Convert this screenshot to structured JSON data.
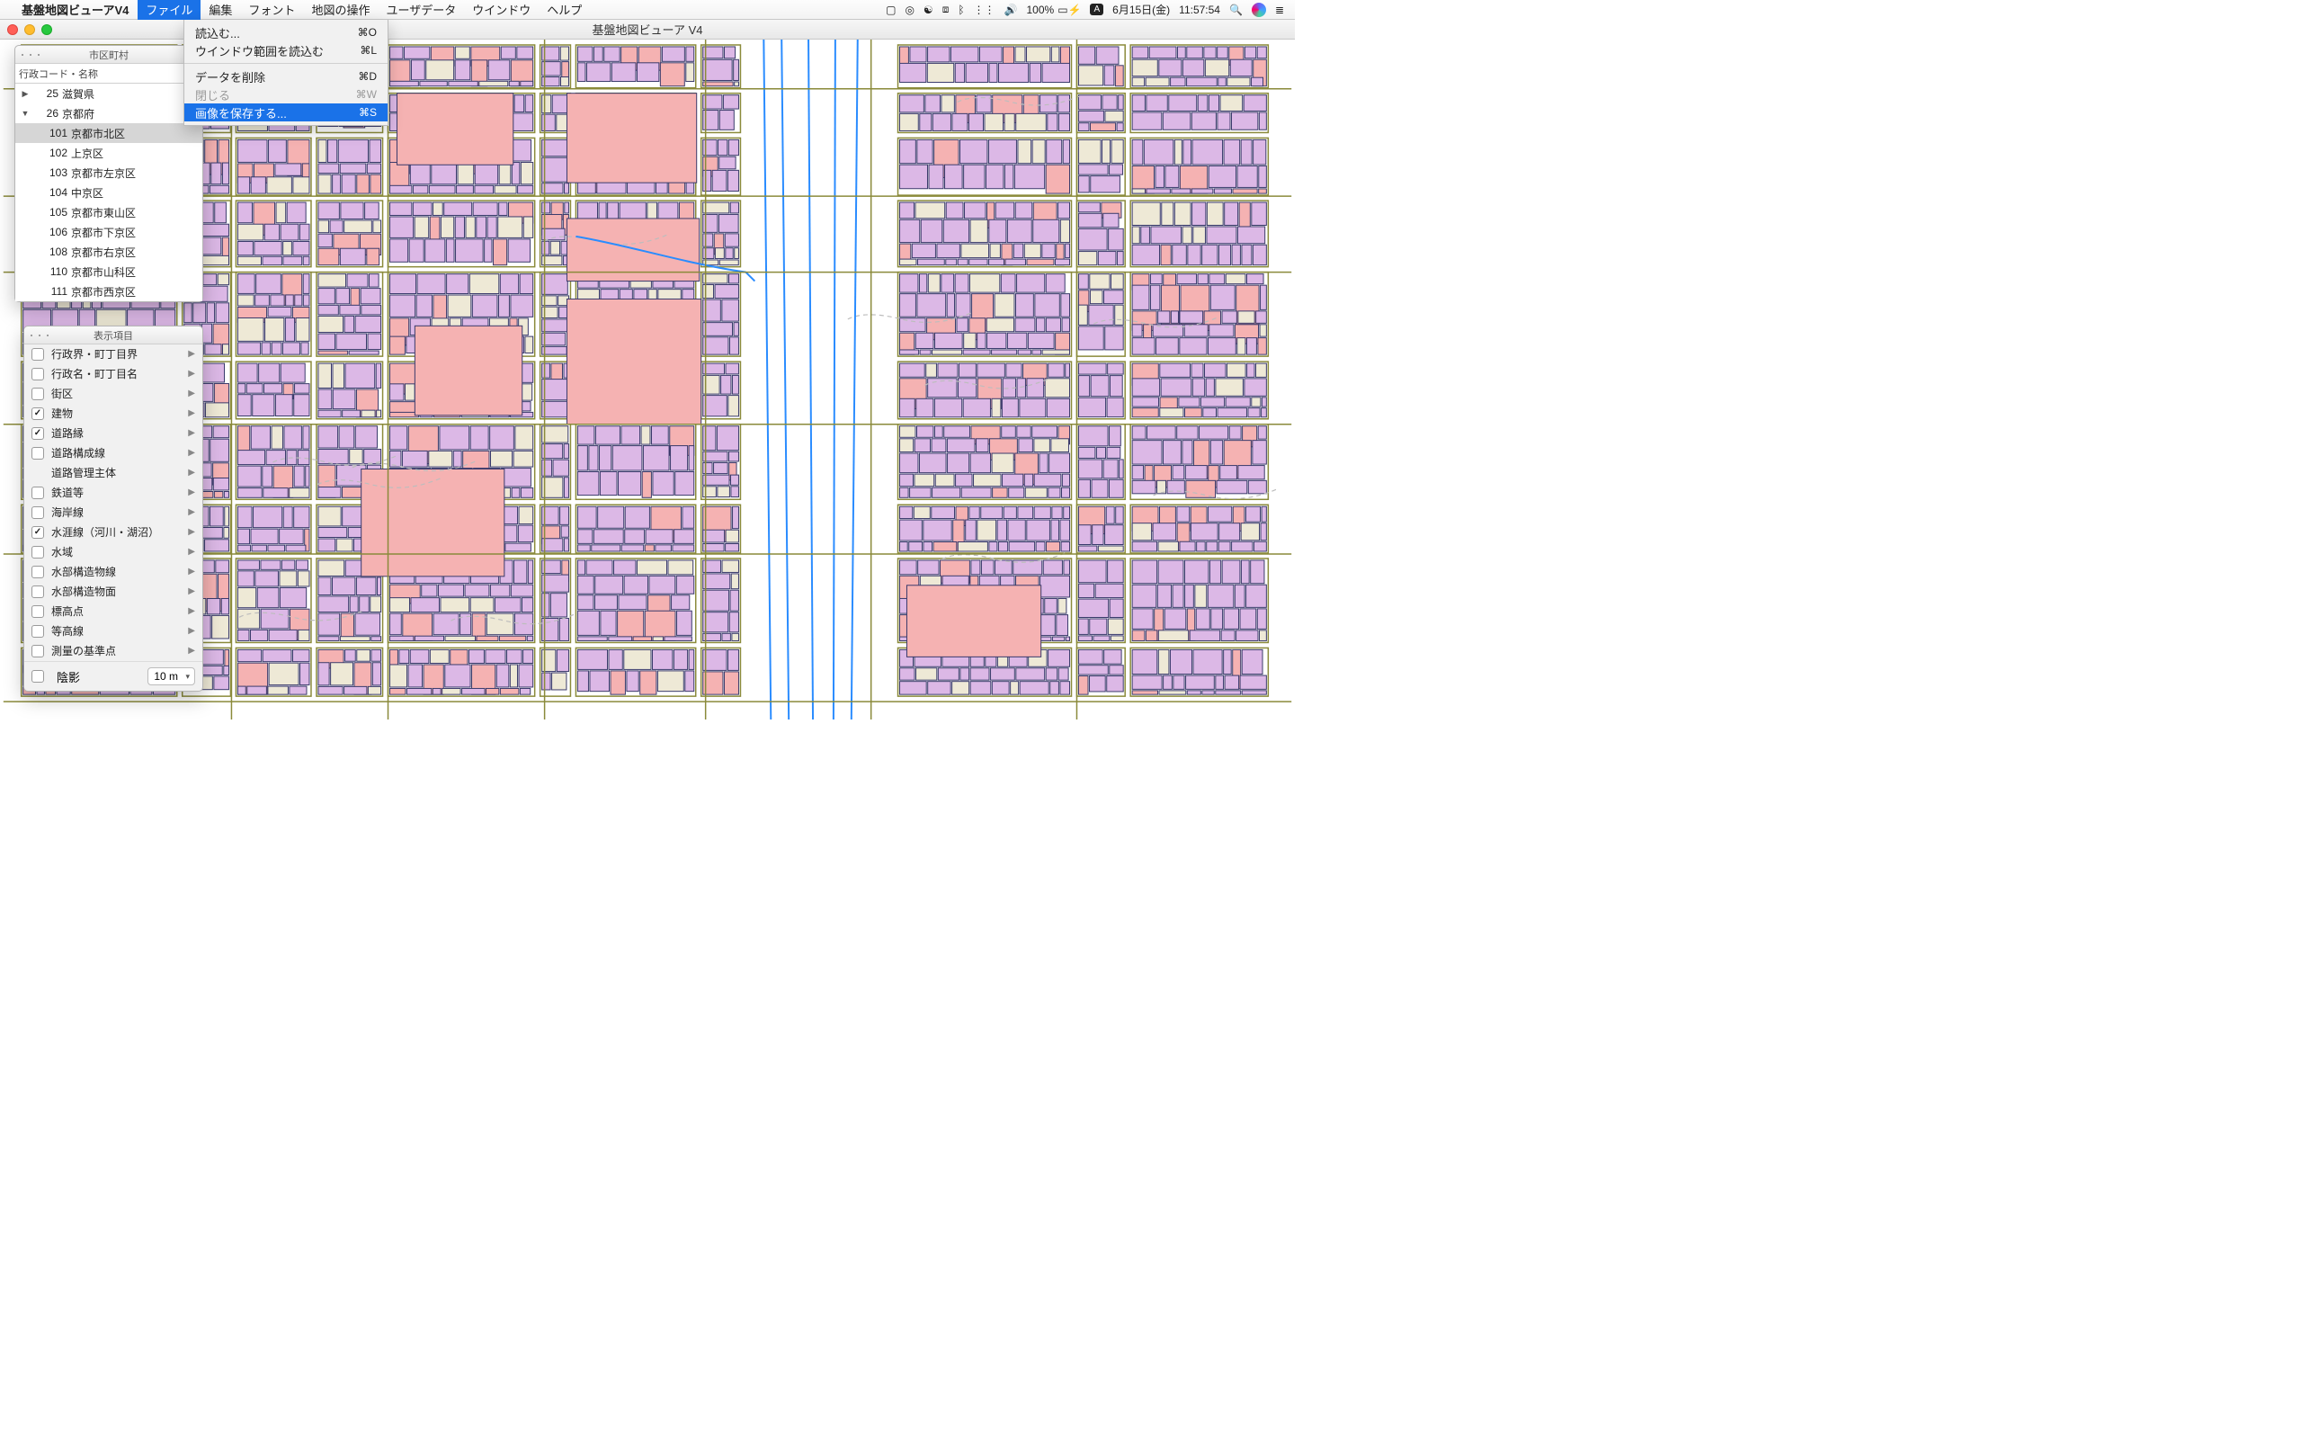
{
  "menubar": {
    "app_name": "基盤地図ビューアV4",
    "items": [
      "ファイル",
      "編集",
      "フォント",
      "地図の操作",
      "ユーザデータ",
      "ウインドウ",
      "ヘルプ"
    ],
    "active_index": 0,
    "right": {
      "battery_pct": "100%",
      "ime": "A",
      "date": "6月15日(金)",
      "time": "11:57:54"
    }
  },
  "file_menu": {
    "items": [
      {
        "label": "読込む...",
        "shortcut": "⌘O",
        "enabled": true
      },
      {
        "label": "ウインドウ範囲を読込む",
        "shortcut": "⌘L",
        "enabled": true
      },
      {
        "sep": true
      },
      {
        "label": "データを削除",
        "shortcut": "⌘D",
        "enabled": true
      },
      {
        "label": "閉じる",
        "shortcut": "⌘W",
        "enabled": false
      },
      {
        "label": "画像を保存する...",
        "shortcut": "⌘S",
        "enabled": true,
        "selected": true
      }
    ]
  },
  "main_window": {
    "title": "基盤地図ビューア V4"
  },
  "region_panel": {
    "title": "市区町村",
    "column": "行政コード・名称",
    "rows": [
      {
        "disclosure": "right",
        "code": "25",
        "name": "滋賀県",
        "level": 0
      },
      {
        "disclosure": "down",
        "code": "26",
        "name": "京都府",
        "level": 0
      },
      {
        "code": "101",
        "name": "京都市北区",
        "level": 1,
        "selected": true
      },
      {
        "code": "102",
        "name": "上京区",
        "level": 1
      },
      {
        "code": "103",
        "name": "京都市左京区",
        "level": 1
      },
      {
        "code": "104",
        "name": "中京区",
        "level": 1
      },
      {
        "code": "105",
        "name": "京都市東山区",
        "level": 1
      },
      {
        "code": "106",
        "name": "京都市下京区",
        "level": 1
      },
      {
        "code": "108",
        "name": "京都市右京区",
        "level": 1
      },
      {
        "code": "110",
        "name": "京都市山科区",
        "level": 1
      },
      {
        "code": "111",
        "name": "京都市西京区",
        "level": 1
      }
    ]
  },
  "layers_panel": {
    "title": "表示項目",
    "items": [
      {
        "label": "行政界・町丁目界",
        "checked": false
      },
      {
        "label": "行政名・町丁目名",
        "checked": false
      },
      {
        "label": "街区",
        "checked": false
      },
      {
        "label": "建物",
        "checked": true
      },
      {
        "label": "道路縁",
        "checked": true
      },
      {
        "label": "道路構成線",
        "checked": false
      },
      {
        "label": "道路管理主体",
        "checked": null
      },
      {
        "label": "鉄道等",
        "checked": false
      },
      {
        "label": "海岸線",
        "checked": false
      },
      {
        "label": "水涯線（河川・湖沼）",
        "checked": true
      },
      {
        "label": "水域",
        "checked": false
      },
      {
        "label": "水部構造物線",
        "checked": false
      },
      {
        "label": "水部構造物面",
        "checked": false
      },
      {
        "label": "標高点",
        "checked": false
      },
      {
        "label": "等高線",
        "checked": false
      },
      {
        "label": "測量の基準点",
        "checked": false
      }
    ],
    "shadow_label": "陰影",
    "shadow_value": "10 m"
  }
}
